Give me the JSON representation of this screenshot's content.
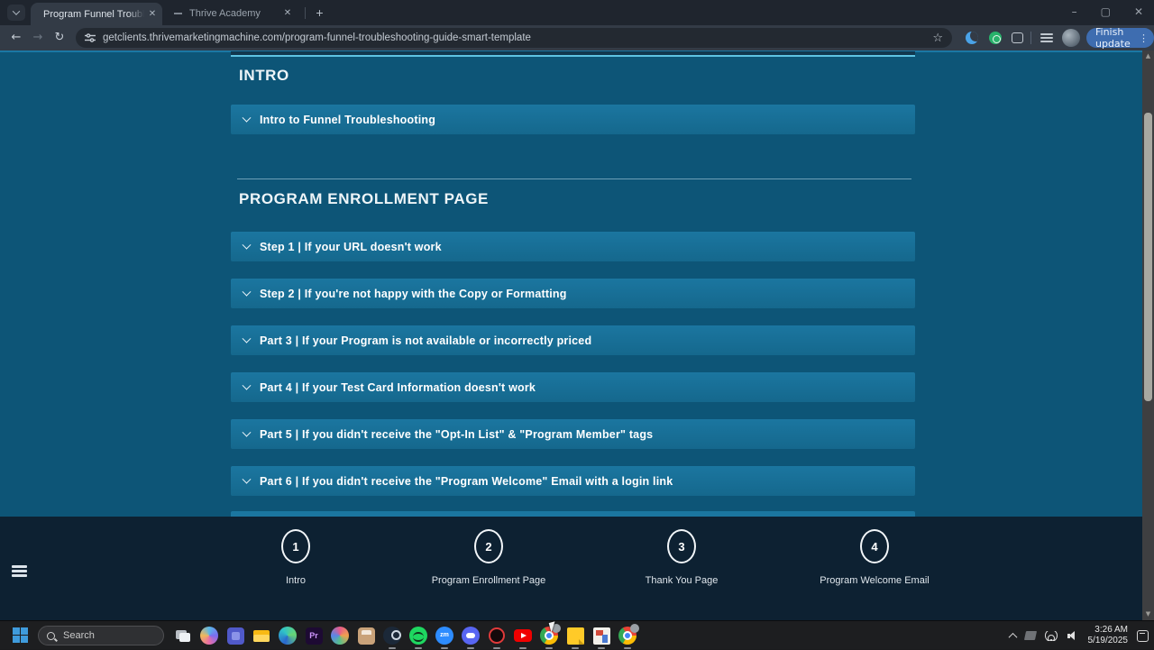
{
  "browser": {
    "tab1_title": "Program Funnel Troubleshooti",
    "tab2_title": "Thrive Academy",
    "new_tab": "+",
    "url": "getclients.thrivemarketingmachine.com/program-funnel-troubleshooting-guide-smart-template",
    "update_label": "Finish update",
    "close_glyph": "✕",
    "min_glyph": "–",
    "max_glyph": "▢",
    "back_glyph": "←",
    "forward_glyph": "→",
    "reload_glyph": "↻",
    "star_glyph": "☆",
    "kebab_glyph": "⋮"
  },
  "page": {
    "sections": [
      {
        "title": "INTRO",
        "items": [
          "Intro to Funnel Troubleshooting"
        ]
      },
      {
        "title": "PROGRAM ENROLLMENT PAGE",
        "items": [
          "Step 1 | If your URL doesn't work",
          "Step 2 | If you're not happy with the Copy or Formatting",
          "Part 3 | If your Program is not available or incorrectly priced",
          "Part 4 | If your Test Card Information doesn't work",
          "Part 5 | If you didn't receive the \"Opt-In List\" & \"Program Member\" tags",
          "Part 6 | If you didn't receive the \"Program Welcome\" Email with a login link"
        ]
      }
    ],
    "stepper": [
      {
        "num": "1",
        "label": "Intro"
      },
      {
        "num": "2",
        "label": "Program Enrollment Page"
      },
      {
        "num": "3",
        "label": "Thank You Page"
      },
      {
        "num": "4",
        "label": "Program Welcome Email"
      }
    ]
  },
  "taskbar": {
    "search_placeholder": "Search",
    "time": "3:26 AM",
    "date": "5/19/2025",
    "app_icons": [
      "task-view",
      "copilot",
      "teams",
      "file-explorer",
      "edge",
      "premiere-pro",
      "colorful-app",
      "ms-store",
      "steam",
      "spotify",
      "zoom",
      "discord",
      "opera-gx",
      "youtube",
      "chrome",
      "sticky-notes",
      "game-tool",
      "chrome-alt"
    ]
  },
  "colors": {
    "content_bg": "#0d5577",
    "accordion_bg": "#18719a",
    "accent_cyan": "#5ec3e2",
    "footer_bg": "#0d2132",
    "update_button": "#3e6db0",
    "taskbar_bg": "#1d1e20"
  },
  "scrollbar": {
    "up_glyph": "▲",
    "down_glyph": "▼"
  }
}
